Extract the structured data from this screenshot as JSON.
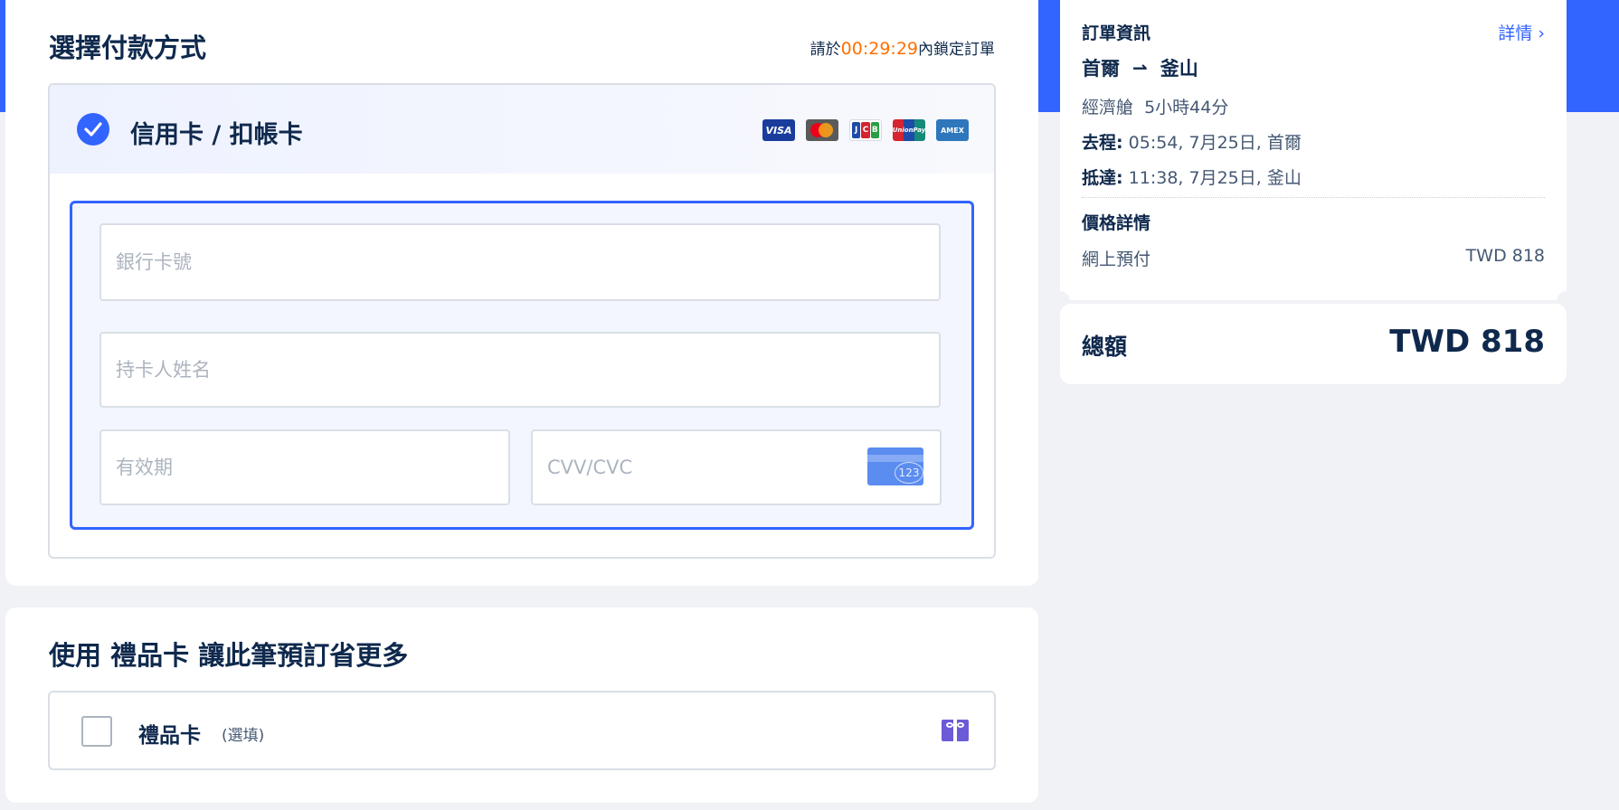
{
  "payment": {
    "title": "選擇付款方式",
    "timer_prefix": "請於",
    "timer_time": "00:29:29",
    "timer_suffix": "內鎖定訂單",
    "method_label": "信用卡 / 扣帳卡",
    "card_brands": [
      "VISA",
      "Mastercard",
      "JCB",
      "UnionPay",
      "AMEX"
    ],
    "card_number_placeholder": "銀行卡號",
    "cardholder_placeholder": "持卡人姓名",
    "expiry_placeholder": "有效期",
    "cvv_placeholder": "CVV/CVC",
    "cvv_icon_text": "123"
  },
  "gift": {
    "title": "使用 禮品卡 讓此筆預訂省更多",
    "label": "禮品卡",
    "optional": "(選填)"
  },
  "order": {
    "title": "訂單資訊",
    "details_link": "詳情 ›",
    "from": "首爾",
    "arrow": "⇀",
    "to": "釜山",
    "cabin": "經濟艙  5小時44分",
    "departure_label": "去程:",
    "departure_value": " 05:54, 7月25日, 首爾",
    "arrival_label": "抵達:",
    "arrival_value": " 11:38, 7月25日, 釜山",
    "price_title": "價格詳情",
    "online_label": "網上預付",
    "online_value": "TWD 818",
    "total_label": "總額",
    "total_value": "TWD 818"
  },
  "colors": {
    "accent": "#3264ff",
    "timer": "#ff6f00",
    "text": "#0f294d",
    "background": "#f0f2f6"
  }
}
